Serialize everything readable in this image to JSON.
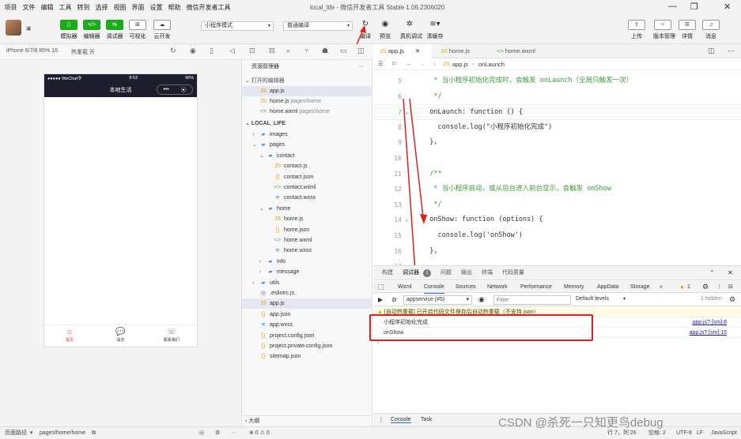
{
  "menu": [
    "项目",
    "文件",
    "编辑",
    "工具",
    "转到",
    "选择",
    "视图",
    "界面",
    "设置",
    "帮助",
    "微信开发者工具"
  ],
  "window": {
    "title": "local_life - 微信开发者工具 Stable 1.06.2306020",
    "min": "—",
    "max": "▢",
    "restore": "❐",
    "close": "✕"
  },
  "toolbar": {
    "buttons": [
      {
        "label": "模拟器",
        "icon": "▯"
      },
      {
        "label": "编辑器",
        "icon": "</>"
      },
      {
        "label": "调试器",
        "icon": "⇆"
      },
      {
        "label": "可视化",
        "icon": "⊞"
      },
      {
        "label": "云开发",
        "icon": "☁"
      }
    ],
    "mode_select": "小程序模式",
    "compile_select": "普通编译",
    "compile": "编译",
    "preview": "预览",
    "real_debug": "真机调试",
    "clear_cache": "清缓存",
    "upload": "上传",
    "version": "版本管理",
    "details": "详情",
    "messages": "消息"
  },
  "sim_bar": {
    "device": "iPhone 6/7/8 85% 16",
    "hot_reload": "热重载 开"
  },
  "phone": {
    "carrier": "●●●●● WeChat令",
    "time": "8:53",
    "battery": "96%",
    "title": "本地生活",
    "capsule_more": "•••",
    "capsule_close": "⦿",
    "tabs": [
      {
        "icon": "⌂",
        "label": "首页"
      },
      {
        "icon": "💬",
        "label": "消息"
      },
      {
        "icon": "☏",
        "label": "联系我们"
      }
    ]
  },
  "explorer": {
    "title": "资源管理器",
    "more": "···",
    "open_editors": "打开的编辑器",
    "open_files": [
      {
        "name": "app.js",
        "path": ""
      },
      {
        "name": "home.js",
        "path": "pages\\home"
      },
      {
        "name": "home.wxml",
        "path": "pages\\home"
      }
    ],
    "project": "LOCAL_LIFE",
    "tree": [
      {
        "name": "images",
        "type": "folder",
        "depth": 1,
        "arrow": "›"
      },
      {
        "name": "pages",
        "type": "folder",
        "depth": 1,
        "arrow": "⌄"
      },
      {
        "name": "contact",
        "type": "folder",
        "depth": 2,
        "arrow": "⌄"
      },
      {
        "name": "contact.js",
        "type": "js",
        "depth": 3
      },
      {
        "name": "contact.json",
        "type": "json",
        "depth": 3
      },
      {
        "name": "contact.wxml",
        "type": "wxml",
        "depth": 3
      },
      {
        "name": "contact.wxss",
        "type": "wxss",
        "depth": 3
      },
      {
        "name": "home",
        "type": "folder",
        "depth": 2,
        "arrow": "⌄"
      },
      {
        "name": "home.js",
        "type": "js",
        "depth": 3
      },
      {
        "name": "home.json",
        "type": "json",
        "depth": 3
      },
      {
        "name": "home.wxml",
        "type": "wxml",
        "depth": 3
      },
      {
        "name": "home.wxss",
        "type": "wxss",
        "depth": 3
      },
      {
        "name": "info",
        "type": "folder",
        "depth": 2,
        "arrow": "›"
      },
      {
        "name": "message",
        "type": "folder",
        "depth": 2,
        "arrow": "›"
      },
      {
        "name": "utils",
        "type": "folder",
        "depth": 1,
        "arrow": "›"
      },
      {
        "name": ".eslintrc.js",
        "type": "eslint",
        "depth": 1
      },
      {
        "name": "app.js",
        "type": "js",
        "depth": 1,
        "selected": true
      },
      {
        "name": "app.json",
        "type": "json",
        "depth": 1
      },
      {
        "name": "app.wxss",
        "type": "wxss",
        "depth": 1
      },
      {
        "name": "project.config.json",
        "type": "json",
        "depth": 1
      },
      {
        "name": "project.private.config.json",
        "type": "json",
        "depth": 1
      },
      {
        "name": "sitemap.json",
        "type": "json",
        "depth": 1
      }
    ],
    "outline": "大纲"
  },
  "editor": {
    "tabs": [
      {
        "name": "app.js",
        "active": true
      },
      {
        "name": "home.js"
      },
      {
        "name": "home.wxml"
      }
    ],
    "breadcrumb_file": "app.js",
    "breadcrumb_symbol": "onLaunch",
    "lines": [
      {
        "n": "5",
        "text": "   * 当小程序初始化完成时，会触发 onLaunch（全局只触发一次）",
        "cls": "cm"
      },
      {
        "n": "6",
        "text": "   */",
        "cls": "cm"
      },
      {
        "n": "7",
        "text": "  onLaunch: function () {",
        "cls": ""
      },
      {
        "n": "8",
        "text": "    console.log(\"小程序初始化完成\")",
        "cls": ""
      },
      {
        "n": "9",
        "text": "  },",
        "cls": ""
      },
      {
        "n": "10",
        "text": "",
        "cls": ""
      },
      {
        "n": "11",
        "text": "  /**",
        "cls": "cm"
      },
      {
        "n": "12",
        "text": "   * 当小程序启动，或从后台进入前台显示，会触发 onShow",
        "cls": "cm"
      },
      {
        "n": "13",
        "text": "   */",
        "cls": "cm"
      },
      {
        "n": "14",
        "text": "  onShow: function (options) {",
        "cls": ""
      },
      {
        "n": "15",
        "text": "    console.log('onShow')",
        "cls": ""
      },
      {
        "n": "16",
        "text": "  },",
        "cls": ""
      },
      {
        "n": "17",
        "text": "",
        "cls": ""
      }
    ]
  },
  "panel": {
    "tabs": [
      "构建",
      "调试器",
      "问题",
      "输出",
      "终端",
      "代码质量"
    ],
    "debugger_badge": "1",
    "devtabs": [
      "Wxml",
      "Console",
      "Sources",
      "Network",
      "Performance",
      "Memory",
      "AppData",
      "Storage"
    ],
    "warn_count": "1",
    "context": "appservice (#5)",
    "filter_placeholder": "Filter",
    "levels": "Default levels",
    "hidden": "1 hidden",
    "warning": "[自动热重载] 已开启代码文件保存后自动热重载（不支持 json）",
    "logs": [
      {
        "text": "小程序初始化完成",
        "src": "app.js? [sm]:8"
      },
      {
        "text": "onShow",
        "src": "app.js? [sm]:15"
      }
    ],
    "bottom_tabs": [
      "Console",
      "Task"
    ]
  },
  "statusbar": {
    "path_label": "页面路径",
    "path": "pages/home/home",
    "errors": "⊗ 0 ⚠ 0",
    "cursor": "行 7，列 26",
    "spaces": "空格: 2",
    "encoding": "UTF-8",
    "eol": "LF",
    "lang": "JavaScript"
  },
  "watermark": "CSDN @杀死一只知更鸟debug"
}
